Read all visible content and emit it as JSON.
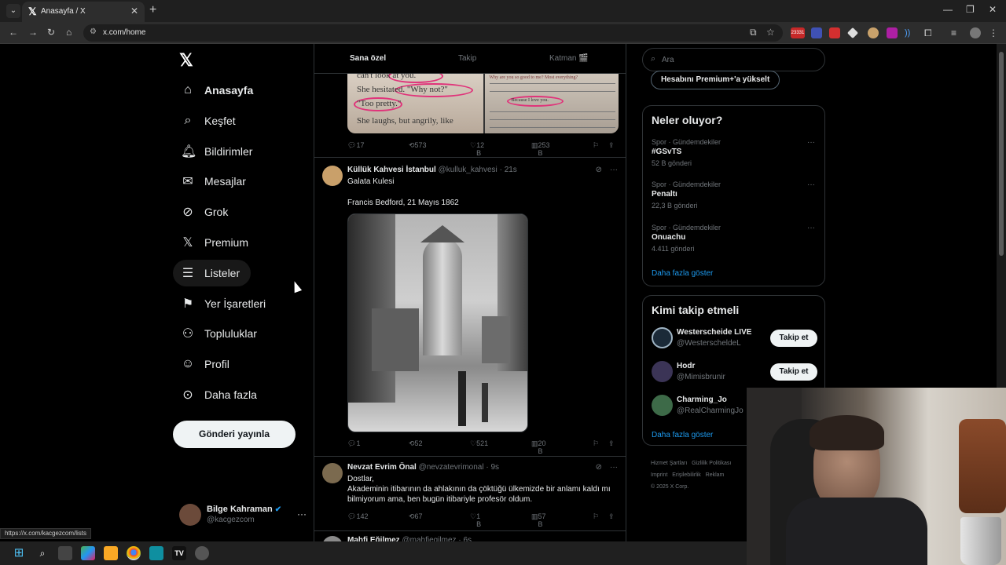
{
  "browser": {
    "tab_title": "Anasayfa / X",
    "tab_favicon": "x-logo-icon",
    "url": "x.com/home",
    "status_url": "https://x.com/kacgezcom/lists",
    "badge_count": "23331"
  },
  "nav": {
    "items": [
      {
        "label": "Anasayfa",
        "icon": "home-icon"
      },
      {
        "label": "Keşfet",
        "icon": "search-icon"
      },
      {
        "label": "Bildirimler",
        "icon": "bell-icon"
      },
      {
        "label": "Mesajlar",
        "icon": "mail-icon"
      },
      {
        "label": "Grok",
        "icon": "grok-icon"
      },
      {
        "label": "Premium",
        "icon": "x-logo-icon"
      },
      {
        "label": "Listeler",
        "icon": "list-icon"
      },
      {
        "label": "Yer İşaretleri",
        "icon": "bookmark-icon"
      },
      {
        "label": "Topluluklar",
        "icon": "communities-icon"
      },
      {
        "label": "Profil",
        "icon": "profile-icon"
      },
      {
        "label": "Daha fazla",
        "icon": "more-circle-icon"
      }
    ],
    "post_button": "Gönderi yayınla",
    "account": {
      "name": "Bilge Kahraman",
      "handle": "@kacgezcom"
    }
  },
  "feed": {
    "tabs": [
      "Sana özel",
      "Takip",
      "Katman 🎬"
    ],
    "book_texts": [
      "can't look at you.",
      "She hesitated. \"Why not?\"",
      "\"Too pretty.\"",
      "She laughs, but angrily, like",
      "Why are you so good to me? Most everything?",
      "Because I love you."
    ],
    "tweet0_actions": {
      "replies": "17",
      "reposts": "573",
      "likes": "12 B",
      "views": "253 B"
    },
    "tweets": [
      {
        "name": "Küllük Kahvesi İstanbul",
        "handle": "@kulluk_kahvesi",
        "time": "21s",
        "line1": "Galata Kulesi",
        "line2": "Francis Bedford, 21 Mayıs 1862",
        "replies": "1",
        "reposts": "52",
        "likes": "521",
        "views": "20 B"
      },
      {
        "name": "Nevzat Evrim Önal",
        "handle": "@nevzatevrimonal",
        "time": "9s",
        "line1": "Dostlar,",
        "line2": "Akademinin itibarının da ahlakının da çöktüğü ülkemizde bir anlamı kaldı mı bilmiyorum ama, ben bugün itibariyle profesör oldum.",
        "replies": "142",
        "reposts": "67",
        "likes": "1 B",
        "views": "57 B"
      }
    ],
    "partial_tweet": {
      "name": "Mahfi Eğilmez",
      "handle": "@mahfiegilmez",
      "time": "6s"
    }
  },
  "right": {
    "search_placeholder": "Ara",
    "premium_button": "Hesabını Premium+'a yükselt",
    "trends_title": "Neler oluyor?",
    "trends": [
      {
        "category": "Spor · Gündemdekiler",
        "name": "#GSvTS",
        "count": "52 B gönderi"
      },
      {
        "category": "Spor · Gündemdekiler",
        "name": "Penaltı",
        "count": "22,3 B gönderi"
      },
      {
        "category": "Spor · Gündemdekiler",
        "name": "Onuachu",
        "count": "4.411 gönderi"
      }
    ],
    "show_more": "Daha fazla göster",
    "wtf_title": "Kimi takip etmeli",
    "who_to_follow": [
      {
        "name": "Westerscheide LIVE",
        "handle": "@WesterscheldeL",
        "button": "Takip et",
        "color": "#1b2a38"
      },
      {
        "name": "Hodr",
        "handle": "@Mimisbrunir",
        "button": "Takip et",
        "color": "#3b3456"
      },
      {
        "name": "Charming_Jo",
        "handle": "@RealCharmingJo",
        "button": "",
        "color": "#3d6a48"
      }
    ],
    "wtf_show_more": "Daha fazla göster",
    "footer": [
      "Hizmet Şartları",
      "Gizlilik Politikası",
      "Imprint",
      "Erişilebilirlik",
      "Reklam",
      "© 2025 X Corp."
    ]
  }
}
